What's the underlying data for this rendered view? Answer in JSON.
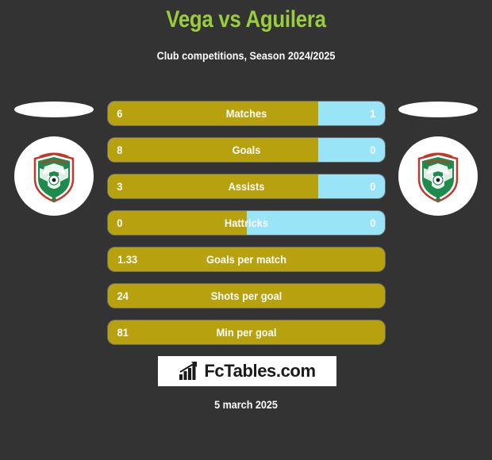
{
  "header": {
    "title": "Vega vs Aguilera",
    "subtitle": "Club competitions, Season 2024/2025",
    "title_color": "#9ACD3C"
  },
  "theme": {
    "background": "#333333",
    "home_color": "#B8A10E",
    "away_color": "#9AE4F7",
    "text_color": "#FFFFFF"
  },
  "badges": {
    "left": {
      "club": "Marathon",
      "crest_colors": [
        "#1E8A4C",
        "#C0392B",
        "#FFFFFF"
      ]
    },
    "right": {
      "club": "Marathon",
      "crest_colors": [
        "#1E8A4C",
        "#C0392B",
        "#FFFFFF"
      ]
    }
  },
  "stats": [
    {
      "label": "Matches",
      "home": "6",
      "away": "1",
      "home_pct": 76,
      "split": true
    },
    {
      "label": "Goals",
      "home": "8",
      "away": "0",
      "home_pct": 76,
      "split": true
    },
    {
      "label": "Assists",
      "home": "3",
      "away": "0",
      "home_pct": 76,
      "split": true
    },
    {
      "label": "Hattricks",
      "home": "0",
      "away": "0",
      "home_pct": 50,
      "split": true
    },
    {
      "label": "Goals per match",
      "home": "1.33",
      "away": "",
      "home_pct": 100,
      "split": false
    },
    {
      "label": "Shots per goal",
      "home": "24",
      "away": "",
      "home_pct": 100,
      "split": false
    },
    {
      "label": "Min per goal",
      "home": "81",
      "away": "",
      "home_pct": 100,
      "split": false
    }
  ],
  "footer": {
    "brand_text": "FcTables.com",
    "brand_icon": "bar-chart-arrow-icon",
    "date": "5 march 2025"
  }
}
